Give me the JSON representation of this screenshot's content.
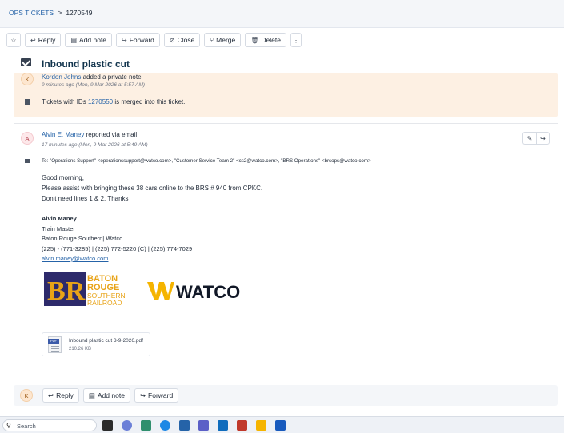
{
  "breadcrumb": {
    "root": "OPS TICKETS",
    "separator": ">",
    "ticket_id": "1270549"
  },
  "toolbar": {
    "reply": "Reply",
    "add_note": "Add note",
    "forward": "Forward",
    "close": "Close",
    "merge": "Merge",
    "delete": "Delete"
  },
  "ticket": {
    "title": "Inbound plastic cut"
  },
  "note": {
    "avatar": "K",
    "author": "Kordon Johns",
    "action": "added a private note",
    "time": "9 minutes ago (Mon, 9 Mar 2026 at 5:57 AM)",
    "merge_prefix": "Tickets with IDs",
    "merge_id": "1270550",
    "merge_suffix": "is merged into this ticket."
  },
  "email": {
    "avatar": "A",
    "sender": "Alvin E. Maney",
    "via": "reported via email",
    "time": "17 minutes ago (Mon, 9 Mar 2026 at 5:49 AM)",
    "to_label": "To:",
    "to": "\"Operations Support\" <operationssupport@watco.com>, \"Customer Service Team 2\" <cs2@watco.com>, \"BRS Operations\" <brsops@watco.com>",
    "body": [
      "Good morning,",
      "Please assist with bringing these 38 cars online to the BRS # 940 from CPKC.",
      "Don't need lines 1 & 2. Thanks"
    ],
    "signature": {
      "name": "Alvin Maney",
      "role": "Train Master",
      "company": "Baton Rouge Southern| Watco",
      "phones": "(225) - (771-3285) | (225) 772-5220 (C) | (225) 774-7029",
      "email": "alvin.maney@watco.com"
    },
    "logos": {
      "brs": [
        "BATON",
        "ROUGE",
        "SOUTHERN",
        "RAILROAD"
      ],
      "brs_mark": "BR",
      "watco": "WATCO"
    },
    "attachment": {
      "name": "Inbound plastic cut 3-9-2026.pdf",
      "size": "210.26 KB",
      "type_tag": "PDF"
    }
  },
  "reply_bar": {
    "avatar": "K",
    "reply": "Reply",
    "add_note": "Add note",
    "forward": "Forward"
  },
  "taskbar": {
    "search_placeholder": "Search"
  },
  "colors": {
    "link": "#2563a8",
    "title": "#12344d",
    "note_bg": "#fdf0e3",
    "watco_yellow": "#f5b400",
    "brs_navy": "#2d2a6b",
    "brs_gold": "#e8a317"
  },
  "icons": [
    "star-icon",
    "reply-icon",
    "note-icon",
    "forward-icon",
    "close-circle-icon",
    "merge-icon",
    "trash-icon",
    "more-vertical-icon",
    "envelope-icon",
    "edit-icon",
    "search-icon"
  ]
}
